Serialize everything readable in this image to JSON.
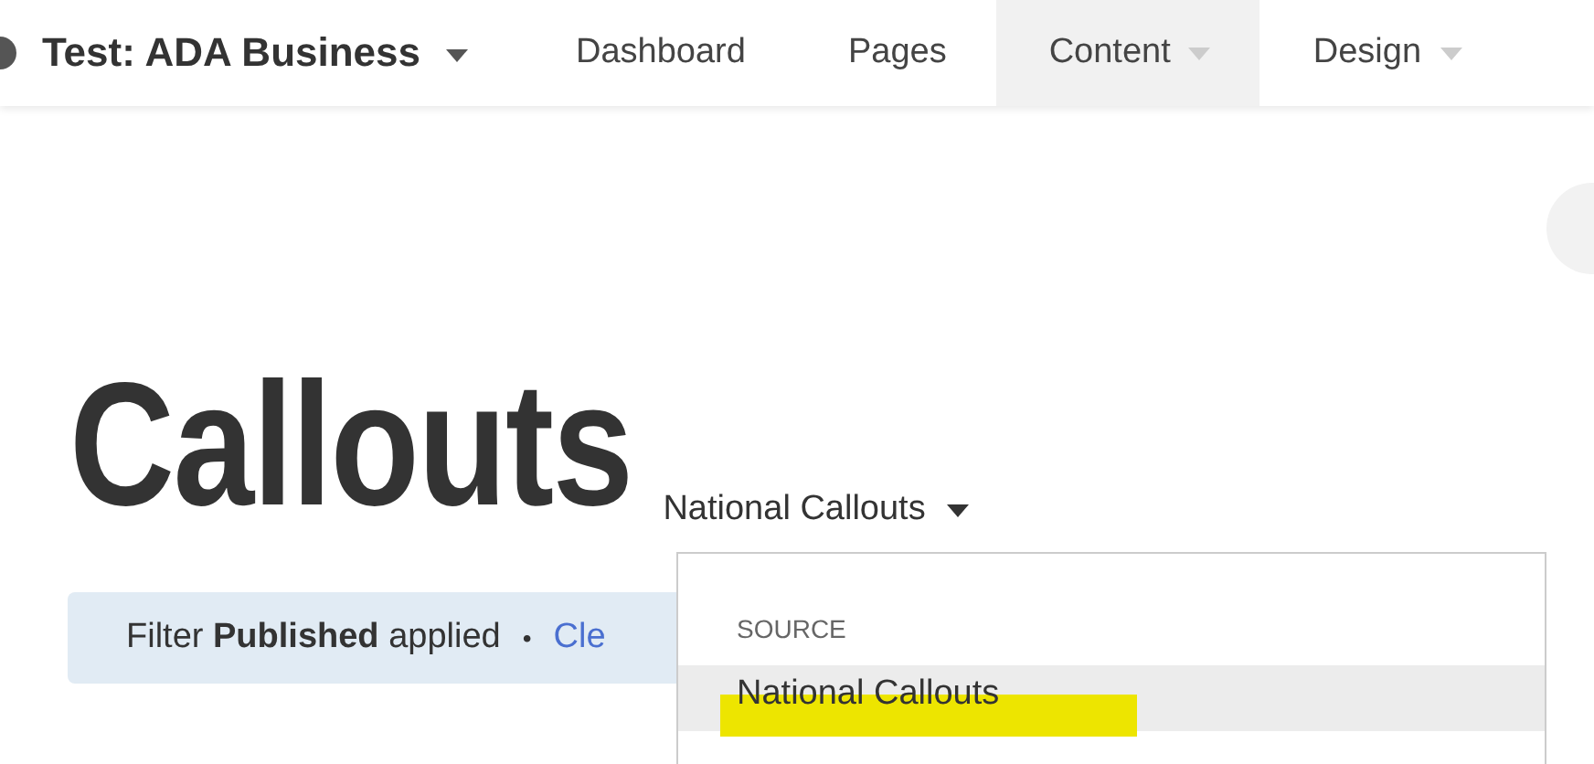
{
  "site": {
    "title": "Test: ADA Business"
  },
  "nav": [
    {
      "label": "Dashboard",
      "has_menu": false,
      "selected": false
    },
    {
      "label": "Pages",
      "has_menu": false,
      "selected": false
    },
    {
      "label": "Content",
      "has_menu": true,
      "selected": true
    },
    {
      "label": "Design",
      "has_menu": true,
      "selected": false
    }
  ],
  "page": {
    "heading": "Callouts",
    "source_button": "National Callouts"
  },
  "filter": {
    "text": "Filter **Published** applied",
    "separator": "•",
    "link": "Cle"
  },
  "dropdown": {
    "section": "SOURCE",
    "items": [
      {
        "label": "National Callouts",
        "hovered": true,
        "highlighted": true
      }
    ]
  }
}
